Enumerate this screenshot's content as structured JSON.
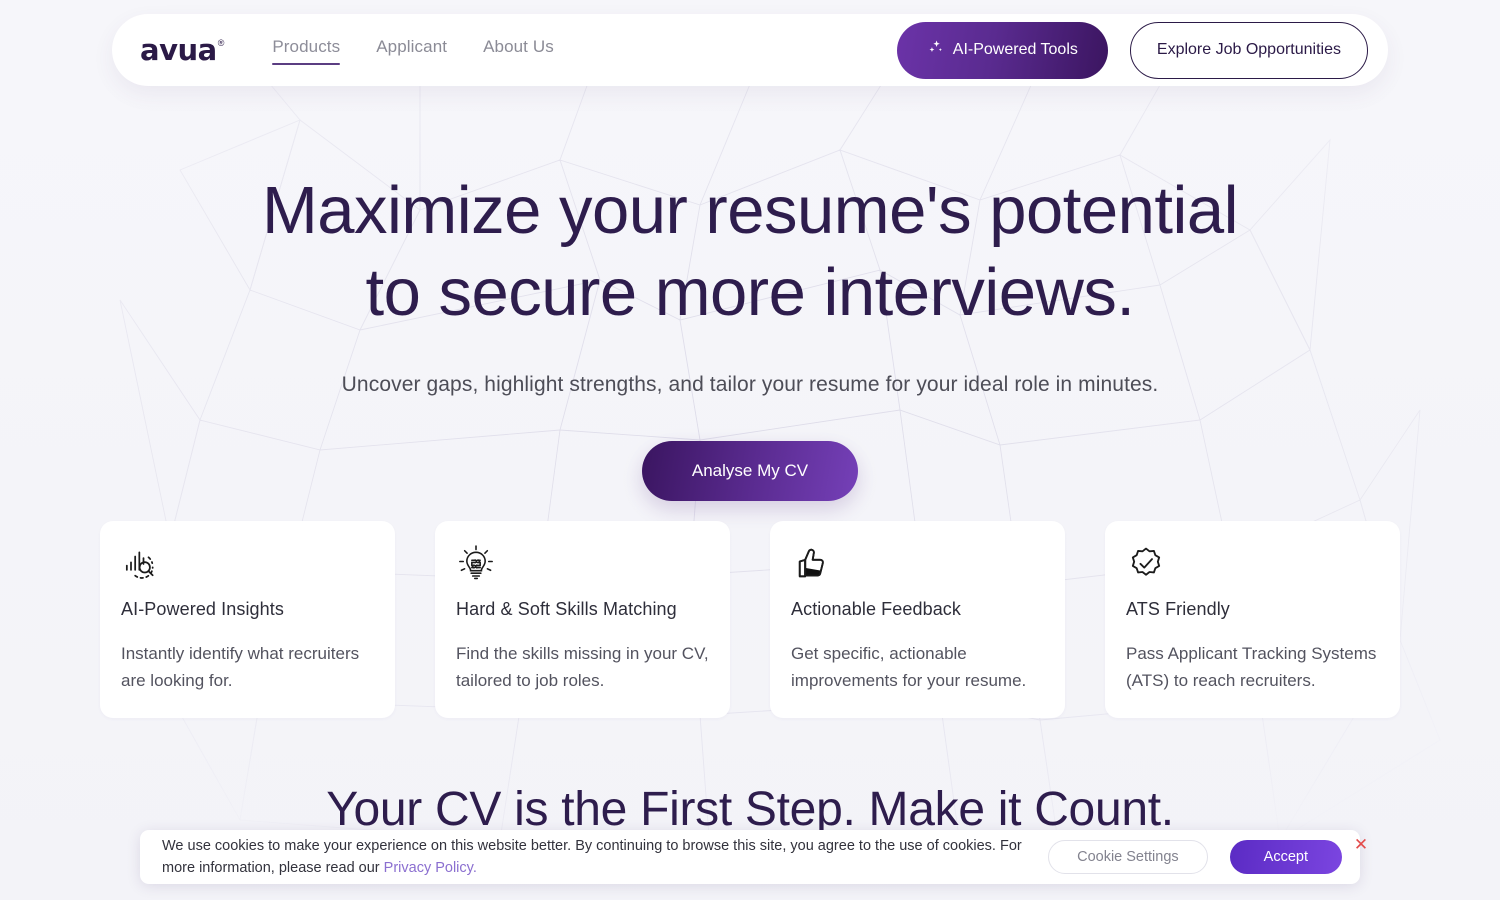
{
  "brand": {
    "logo_text": "avua",
    "registered_mark": "®",
    "accent_purple": "#5b3d82",
    "heading_color": "#2e1d4d",
    "link_purple": "#8b6fd0"
  },
  "header": {
    "nav": [
      {
        "label": "Products",
        "active": true
      },
      {
        "label": "Applicant",
        "active": false
      },
      {
        "label": "About Us",
        "active": false
      }
    ],
    "ai_tools_button": "AI-Powered Tools",
    "ai_tools_icon": "sparkles-icon",
    "explore_button": "Explore Job Opportunities"
  },
  "hero": {
    "title_line1": "Maximize your resume's potential",
    "title_line2": "to secure more interviews.",
    "subtitle": "Uncover gaps, highlight strengths, and tailor your resume for your ideal role in minutes.",
    "cta_label": "Analyse My CV"
  },
  "features": [
    {
      "icon": "bar-chart-magnifier-icon",
      "title": "AI-Powered Insights",
      "desc": "Instantly identify what recruiters are looking for."
    },
    {
      "icon": "lightbulb-puzzle-icon",
      "title": "Hard & Soft Skills Matching",
      "desc": "Find the skills missing in your CV, tailored to job roles."
    },
    {
      "icon": "thumbs-up-icon",
      "title": "Actionable Feedback",
      "desc": "Get specific, actionable improvements for your resume."
    },
    {
      "icon": "verified-badge-check-icon",
      "title": "ATS Friendly",
      "desc": "Pass Applicant Tracking Systems (ATS) to reach recruiters."
    }
  ],
  "section2": {
    "title": "Your CV is the First Step. Make it Count."
  },
  "cookie_banner": {
    "text_before_link": "We use cookies to make your experience on this website better. By continuing to browse this site, you agree to the use of cookies. For more information, please read our ",
    "link_label": "Privacy Policy.",
    "settings_button": "Cookie Settings",
    "accept_button": "Accept",
    "close_icon": "✕"
  }
}
